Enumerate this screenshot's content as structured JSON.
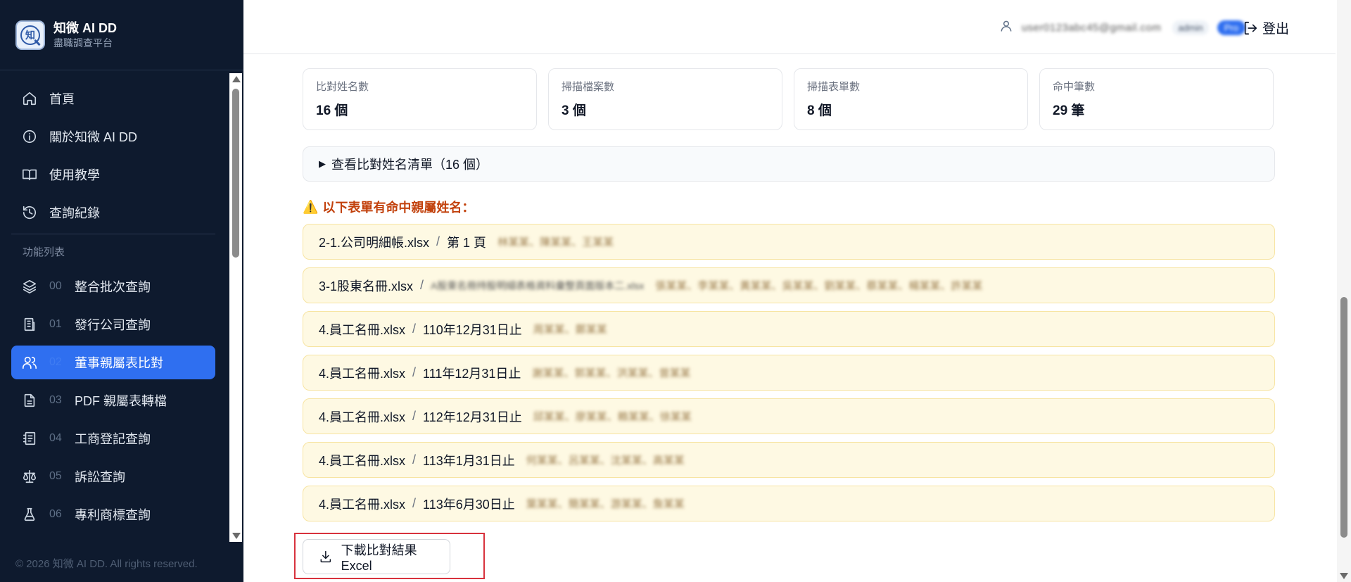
{
  "brand": {
    "title": "知微 AI DD",
    "subtitle": "盡職調查平台",
    "logo_glyph": "知"
  },
  "nav": {
    "main": [
      {
        "label": "首頁",
        "icon": "home-icon"
      },
      {
        "label": "關於知微 AI DD",
        "icon": "info-icon"
      },
      {
        "label": "使用教學",
        "icon": "book-icon"
      },
      {
        "label": "查詢紀錄",
        "icon": "history-icon"
      }
    ],
    "section_title": "功能列表",
    "features": [
      {
        "num": "00",
        "label": "整合批次查詢",
        "icon": "layers-icon"
      },
      {
        "num": "01",
        "label": "發行公司查詢",
        "icon": "building-icon"
      },
      {
        "num": "02",
        "label": "董事親屬表比對",
        "icon": "users-icon",
        "active": true
      },
      {
        "num": "03",
        "label": "PDF 親屬表轉檔",
        "icon": "file-text-icon"
      },
      {
        "num": "04",
        "label": "工商登記查詢",
        "icon": "register-icon"
      },
      {
        "num": "05",
        "label": "訴訟查詢",
        "icon": "scale-icon"
      },
      {
        "num": "06",
        "label": "專利商標查詢",
        "icon": "flask-icon"
      }
    ]
  },
  "footer": "© 2026 知微 AI DD. All rights reserved.",
  "header": {
    "email": "user0123abc45@gmail.com",
    "role": "admin",
    "plan": "Pro",
    "logout_label": "登出"
  },
  "stats": [
    {
      "label": "比對姓名數",
      "value": "16 個"
    },
    {
      "label": "掃描檔案數",
      "value": "3 個"
    },
    {
      "label": "掃描表單數",
      "value": "8 個"
    },
    {
      "label": "命中筆數",
      "value": "29 筆"
    }
  ],
  "details_label": "查看比對姓名清單（16 個）",
  "warning": "以下表單有命中親屬姓名：",
  "hits": [
    {
      "file": "2-1.公司明細帳.xlsx",
      "sheet": "第 1 頁",
      "names": "林某某、陳某某、王某某"
    },
    {
      "file": "3-1股東名冊.xlsx",
      "sheet": "A股東名冊持股明細表格資料彙整頁面版本二.xlsx",
      "names": "張某某、李某某、黃某某、吳某某、劉某某、蔡某某、楊某某、許某某"
    },
    {
      "file": "4.員工名冊.xlsx",
      "sheet": "110年12月31日止",
      "names": "周某某、鄭某某"
    },
    {
      "file": "4.員工名冊.xlsx",
      "sheet": "111年12月31日止",
      "names": "謝某某、郭某某、洪某某、曾某某"
    },
    {
      "file": "4.員工名冊.xlsx",
      "sheet": "112年12月31日止",
      "names": "邱某某、廖某某、賴某某、徐某某"
    },
    {
      "file": "4.員工名冊.xlsx",
      "sheet": "113年1月31日止",
      "names": "何某某、呂某某、沈某某、高某某"
    },
    {
      "file": "4.員工名冊.xlsx",
      "sheet": "113年6月30日止",
      "names": "葉某某、簡某某、游某某、詹某某"
    }
  ],
  "download_label": "下載比對結果 Excel",
  "colors": {
    "sidebar_bg": "#0e1a2e",
    "accent": "#2f6ff0",
    "warning": "#c2410c",
    "hit_bg": "#fef9e3",
    "highlight_border": "#d8323d"
  }
}
